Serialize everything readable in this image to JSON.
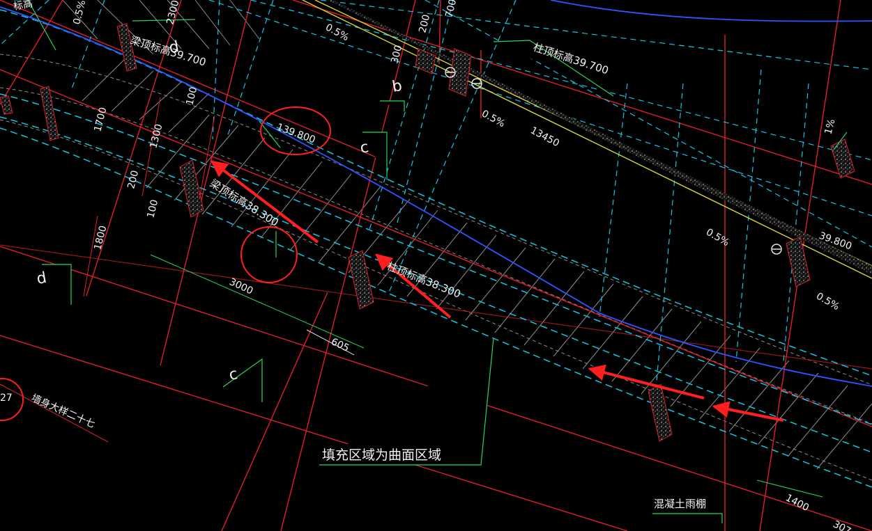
{
  "canvas": {
    "background": "#000000"
  },
  "colors": {
    "cyan": "#12c7e6",
    "red": "#e01e2a",
    "white": "#e7e7e7",
    "yellow": "#d8d83b",
    "blue": "#2d56ff",
    "green": "#22d95c",
    "gray": "#9a9a9a",
    "annotation_red": "#ff1f1f"
  },
  "labels": {
    "beam_top_elev_top": "梁顶标高39.700",
    "column_top_elev_top": "柱顶标高39.700",
    "beam_top_elev_mid": "梁顶标高38.300",
    "column_top_elev_mid": "柱顶标高38.300",
    "circled_elev": "139.800",
    "right_elev": "39.800",
    "fill_note": "填充区域为曲面区域",
    "wall_detail": "墙身大样二十七",
    "concrete_canopy": "混凝土雨棚",
    "slope_1": "0.5%",
    "slope_2": "0.5%",
    "slope_3": "0.5%",
    "slope_4": "0.5%",
    "slope_5": "1%",
    "slope_top_left": "0.5%",
    "dim_1700": "1700",
    "dim_1300": "1300",
    "dim_200_left": "200",
    "dim_100_left": "100",
    "dim_100_top": "100",
    "dim_1800": "1800",
    "dim_3000": "3000",
    "dim_605": "605",
    "dim_13450": "13450",
    "dim_300": "300",
    "dim_200_top": "200",
    "dim_700": "700",
    "dim_2300": "2300",
    "dim_1400": "1400",
    "dim_307": "307",
    "grid_d_top": "d",
    "grid_b": "b",
    "grid_c_top": "c",
    "grid_d_left": "d",
    "grid_c_bottom": "c",
    "detail_no": "27",
    "partial_top_left": "标高"
  }
}
